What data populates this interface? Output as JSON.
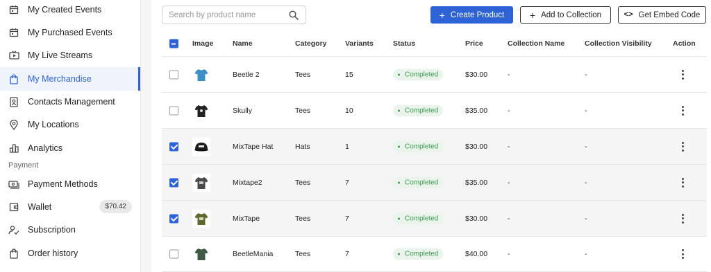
{
  "sidebar": {
    "items": [
      {
        "label": "My Created Events",
        "icon": "calendar-icon"
      },
      {
        "label": "My Purchased Events",
        "icon": "calendar-icon"
      },
      {
        "label": "My Live Streams",
        "icon": "tv-icon"
      },
      {
        "label": "My Merchandise",
        "icon": "shopping-bag-icon",
        "active": true
      },
      {
        "label": "Contacts Management",
        "icon": "contacts-icon"
      },
      {
        "label": "My Locations",
        "icon": "location-pin-icon"
      },
      {
        "label": "Analytics",
        "icon": "bar-chart-icon"
      }
    ],
    "section_payment": "Payment",
    "payment_items": [
      {
        "label": "Payment Methods",
        "icon": "payment-icon"
      },
      {
        "label": "Wallet",
        "icon": "wallet-icon",
        "badge": "$70.42"
      },
      {
        "label": "Subscription",
        "icon": "subscription-icon"
      },
      {
        "label": "Order history",
        "icon": "shopping-bag-icon"
      }
    ]
  },
  "toolbar": {
    "search_placeholder": "Search by product name",
    "create_label": "Create Product",
    "add_collection_label": "Add to Collection",
    "embed_label": "Get Embed Code"
  },
  "table": {
    "headers": {
      "image": "Image",
      "name": "Name",
      "category": "Category",
      "variants": "Variants",
      "status": "Status",
      "price": "Price",
      "collection_name": "Collection Name",
      "collection_visibility": "Collection Visibility",
      "action": "Action"
    },
    "header_checkbox_state": "indeterminate",
    "rows": [
      {
        "name": "Beetle 2",
        "category": "Tees",
        "variants": "15",
        "status": "Completed",
        "price": "$30.00",
        "collection_name": "-",
        "collection_visibility": "-",
        "checked": false,
        "product_color": "#3c8fc4",
        "product_type": "tee"
      },
      {
        "name": "Skully",
        "category": "Tees",
        "variants": "10",
        "status": "Completed",
        "price": "$35.00",
        "collection_name": "-",
        "collection_visibility": "-",
        "checked": false,
        "product_color": "#222222",
        "product_type": "tee"
      },
      {
        "name": "MixTape Hat",
        "category": "Hats",
        "variants": "1",
        "status": "Completed",
        "price": "$30.00",
        "collection_name": "-",
        "collection_visibility": "-",
        "checked": true,
        "product_color": "#1e1e1e",
        "product_type": "hat"
      },
      {
        "name": "Mixtape2",
        "category": "Tees",
        "variants": "7",
        "status": "Completed",
        "price": "$35.00",
        "collection_name": "-",
        "collection_visibility": "-",
        "checked": true,
        "product_color": "#4a4a4a",
        "product_type": "tee"
      },
      {
        "name": "MixTape",
        "category": "Tees",
        "variants": "7",
        "status": "Completed",
        "price": "$30.00",
        "collection_name": "-",
        "collection_visibility": "-",
        "checked": true,
        "product_color": "#5b6b2e",
        "product_type": "tee"
      },
      {
        "name": "BeetleMania",
        "category": "Tees",
        "variants": "7",
        "status": "Completed",
        "price": "$40.00",
        "collection_name": "-",
        "collection_visibility": "-",
        "checked": false,
        "product_color": "#3f5a44",
        "product_type": "tee"
      }
    ]
  },
  "colors": {
    "accent": "#2d63d6",
    "status_green": "#3d9a4d",
    "status_bg": "#eaf4ec",
    "active_bg": "#eef3fc"
  }
}
